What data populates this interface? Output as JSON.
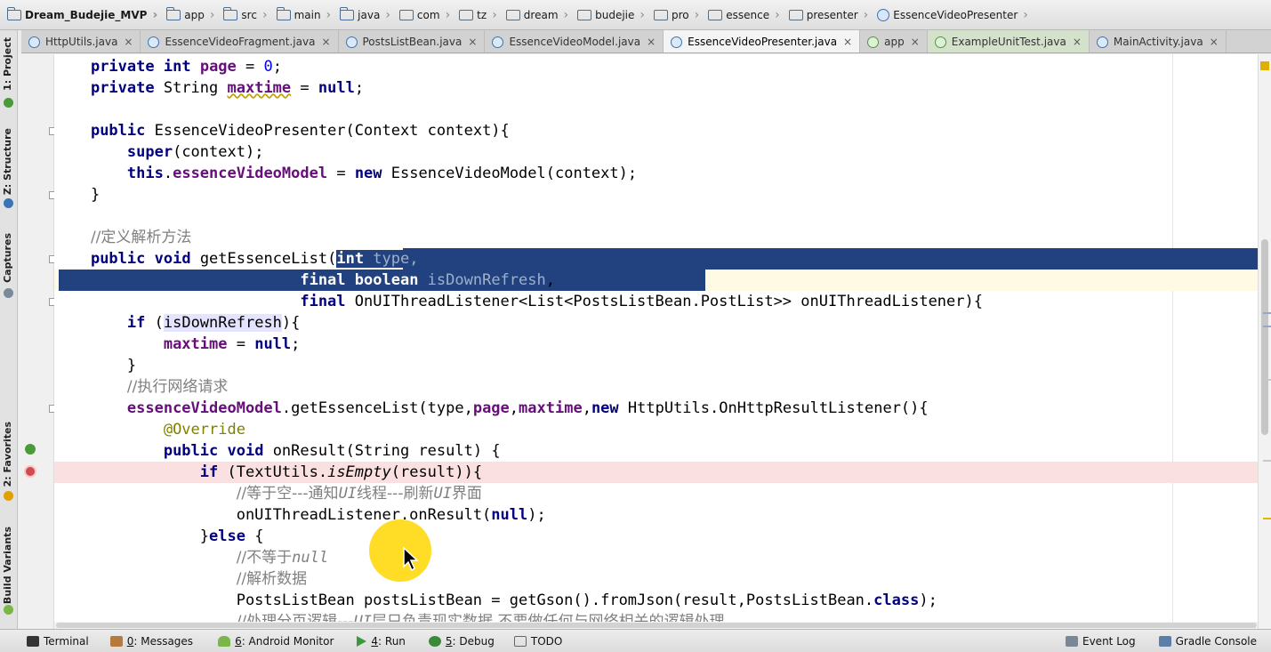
{
  "breadcrumb": [
    {
      "label": "Dream_Budejie_MVP",
      "icon": "folder-icon"
    },
    {
      "label": "app",
      "icon": "folder-icon"
    },
    {
      "label": "src",
      "icon": "folder-icon"
    },
    {
      "label": "main",
      "icon": "folder-icon"
    },
    {
      "label": "java",
      "icon": "folder-icon"
    },
    {
      "label": "com",
      "icon": "package-icon"
    },
    {
      "label": "tz",
      "icon": "package-icon"
    },
    {
      "label": "dream",
      "icon": "package-icon"
    },
    {
      "label": "budejie",
      "icon": "package-icon"
    },
    {
      "label": "pro",
      "icon": "package-icon"
    },
    {
      "label": "essence",
      "icon": "package-icon"
    },
    {
      "label": "presenter",
      "icon": "package-icon"
    },
    {
      "label": "EssenceVideoPresenter",
      "icon": "class-icon"
    }
  ],
  "tabs": [
    {
      "label": "HttpUtils.java",
      "close": "×",
      "state": "normal"
    },
    {
      "label": "EssenceVideoFragment.java",
      "close": "×",
      "state": "normal"
    },
    {
      "label": "PostsListBean.java",
      "close": "×",
      "state": "normal"
    },
    {
      "label": "EssenceVideoModel.java",
      "close": "×",
      "state": "normal"
    },
    {
      "label": "EssenceVideoPresenter.java",
      "close": "×",
      "state": "active"
    },
    {
      "label": "app",
      "close": "×",
      "state": "normal"
    },
    {
      "label": "ExampleUnitTest.java",
      "close": "×",
      "state": "green"
    },
    {
      "label": "MainActivity.java",
      "close": "×",
      "state": "normal"
    }
  ],
  "left_tools": {
    "project": "1: Project",
    "structure": "Z: Structure",
    "captures": "Captures",
    "favorites": "2: Favorites",
    "build_variants": "Build Variants"
  },
  "code": {
    "l1": {
      "kw1": "private",
      "kw2": "int",
      "name": "page",
      "eq": " = ",
      "val": "0",
      "end": ";"
    },
    "l2": {
      "kw1": "private",
      "type": " String ",
      "name": "maxtime",
      "eq": " = ",
      "val": "null",
      "end": ";"
    },
    "l4": {
      "kw": "public",
      "rest": " EssenceVideoPresenter(Context context){"
    },
    "l5": {
      "kw": "super",
      "rest": "(context);"
    },
    "l6": {
      "kw1": "this",
      "dot": ".",
      "field": "essenceVideoModel",
      "eq": " = ",
      "kw2": "new",
      "rest": " EssenceVideoModel(context);"
    },
    "l7": {
      "text": "}"
    },
    "l9": {
      "comment": "//定义解析方法"
    },
    "l10": {
      "kw1": "public",
      "kw2": "void",
      "method": " getEssenceList(",
      "skw": "int",
      "sparam": " type,"
    },
    "l11": {
      "kw1": "final",
      "kw2": "boolean",
      "param": " isDownRefresh",
      "end": ","
    },
    "l12": {
      "kw": "final",
      "rest": " OnUIThreadListener<List<PostsListBean.PostList>> onUIThreadListener){"
    },
    "l13": {
      "kw": "if",
      "open": " (",
      "usage": "isDownRefresh",
      "close": "){"
    },
    "l14": {
      "field": "maxtime",
      "eq": " = ",
      "kw": "null",
      "end": ";"
    },
    "l15": {
      "text": "}"
    },
    "l16": {
      "comment": "//执行网络请求"
    },
    "l17": {
      "field": "essenceVideoModel",
      "call": ".getEssenceList(type,",
      "f2": "page",
      "comma": ",",
      "f3": "maxtime",
      "comma2": ",",
      "kw": "new",
      "rest": " HttpUtils.OnHttpResultListener(){"
    },
    "l18": {
      "ann": "@Override"
    },
    "l19": {
      "kw1": "public",
      "kw2": "void",
      "rest": " onResult(String result) {"
    },
    "l20": {
      "kw": "if",
      "open": " (TextUtils.",
      "italic": "isEmpty",
      "rest": "(result)){"
    },
    "l21": {
      "c1": "//等于空---通知",
      "c2": "UI",
      "c3": "线程---刷新",
      "c4": "UI",
      "c5": "界面"
    },
    "l22": {
      "name": "onUIThreadListener",
      "call": ".onResult(",
      "kw": "null",
      "end": ");"
    },
    "l23": {
      "open": "}",
      "kw": "else",
      "rest": " {"
    },
    "l24": {
      "c1": "//不等于",
      "c2": "null"
    },
    "l25": {
      "comment": "//解析数据"
    },
    "l26": {
      "rest": "PostsListBean postsListBean = getGson().fromJson(result,PostsListBean.",
      "kw": "class",
      "end": ");"
    },
    "l27": {
      "c1": "//处理分页逻辑---",
      "c2": "UI",
      "c3": "层只负责现实数据,不要做任何与网络相关的逻辑处理"
    }
  },
  "bottom_tools": [
    {
      "prefix": "",
      "underline": "",
      "label": "Terminal",
      "icon": "terminal-icon"
    },
    {
      "prefix": "",
      "underline": "0",
      "label": ": Messages",
      "icon": "messages-icon"
    },
    {
      "prefix": "",
      "underline": "6",
      "label": ": Android Monitor",
      "icon": "android-icon"
    },
    {
      "prefix": "",
      "underline": "4",
      "label": ": Run",
      "icon": "run-icon"
    },
    {
      "prefix": "",
      "underline": "5",
      "label": ": Debug",
      "icon": "debug-icon"
    },
    {
      "prefix": "",
      "underline": "",
      "label": "TODO",
      "icon": "todo-icon"
    },
    {
      "prefix": "",
      "underline": "",
      "label": "Event Log",
      "icon": "event-log-icon"
    },
    {
      "prefix": "",
      "underline": "",
      "label": "Gradle Console",
      "icon": "gradle-console-icon"
    }
  ],
  "colors": {
    "keyword": "#000080",
    "field": "#660e7a",
    "comment": "#808080",
    "selection": "#21427f",
    "breakpoint_line": "#fae0e0",
    "caret_line": "#fffae3",
    "cursor_halo": "#ffd600"
  }
}
